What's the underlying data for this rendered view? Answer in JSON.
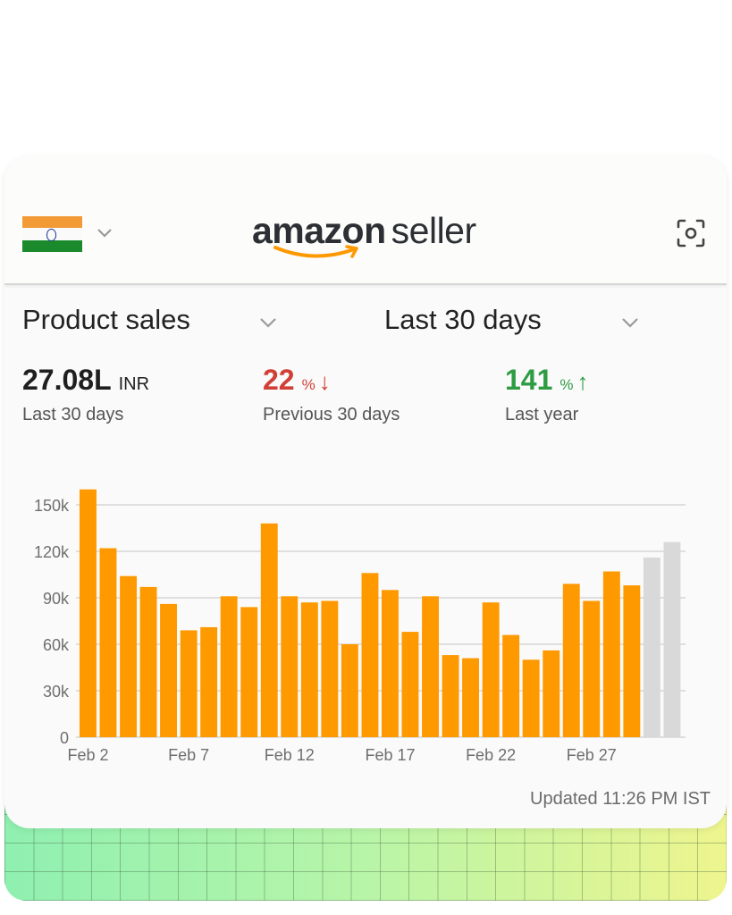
{
  "header": {
    "country_flag_icon": "india-flag-icon",
    "logo_text_bold": "amazon",
    "logo_text_light": "seller",
    "scan_icon": "scan-icon"
  },
  "controls": {
    "metric_label": "Product sales",
    "range_label": "Last 30 days"
  },
  "kpis": {
    "current": {
      "value": "27.08L",
      "unit": "INR",
      "caption": "Last 30 days"
    },
    "previous": {
      "value": "22",
      "unit": "%",
      "arrow": "↓",
      "caption": "Previous 30 days",
      "color": "#d13f36"
    },
    "yoy": {
      "value": "141",
      "unit": "%",
      "arrow": "↑",
      "caption": "Last year",
      "color": "#2e9c43"
    }
  },
  "colors": {
    "bar": "#ff9900",
    "bar_projected": "#d9d9d9",
    "grid": "#cfcfcf"
  },
  "chart_data": {
    "type": "bar",
    "x_tick_labels": [
      "Feb 2",
      "Feb 7",
      "Feb 12",
      "Feb 17",
      "Feb 22",
      "Feb 27"
    ],
    "y_tick_labels": [
      "0",
      "30k",
      "60k",
      "90k",
      "120k",
      "150k"
    ],
    "ylim": [
      0,
      150000
    ],
    "values": [
      160000,
      122000,
      104000,
      97000,
      86000,
      69000,
      71000,
      91000,
      84000,
      138000,
      91000,
      87000,
      88000,
      60000,
      106000,
      95000,
      68000,
      91000,
      53000,
      51000,
      87000,
      66000,
      50000,
      56000,
      99000,
      88000,
      107000,
      98000,
      116000,
      126000
    ],
    "projected": [
      false,
      false,
      false,
      false,
      false,
      false,
      false,
      false,
      false,
      false,
      false,
      false,
      false,
      false,
      false,
      false,
      false,
      false,
      false,
      false,
      false,
      false,
      false,
      false,
      false,
      false,
      false,
      false,
      true,
      true
    ],
    "grid": true
  },
  "footer": {
    "updated": "Updated 11:26 PM IST"
  }
}
